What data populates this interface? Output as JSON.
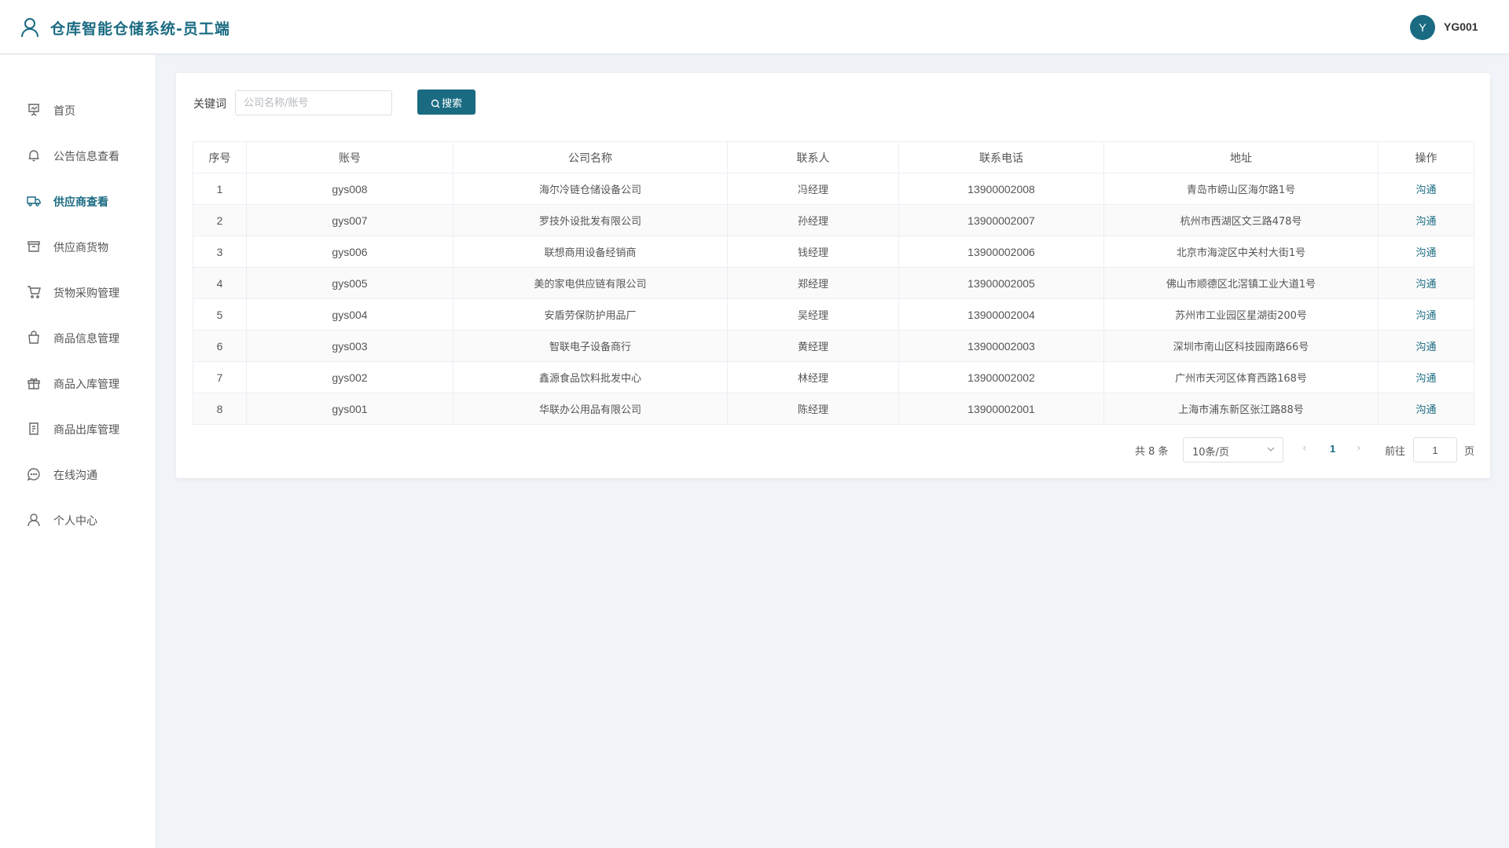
{
  "header": {
    "title": "仓库智能仓储系统-员工端",
    "avatar_letter": "Y",
    "username": "YG001"
  },
  "sidebar": {
    "items": [
      {
        "label": "首页",
        "icon": "presentation-icon"
      },
      {
        "label": "公告信息查看",
        "icon": "bell-icon"
      },
      {
        "label": "供应商查看",
        "icon": "truck-icon",
        "active": true
      },
      {
        "label": "供应商货物",
        "icon": "box-icon"
      },
      {
        "label": "货物采购管理",
        "icon": "cart-icon"
      },
      {
        "label": "商品信息管理",
        "icon": "bag-icon"
      },
      {
        "label": "商品入库管理",
        "icon": "present-icon"
      },
      {
        "label": "商品出库管理",
        "icon": "document-icon"
      },
      {
        "label": "在线沟通",
        "icon": "chat-icon"
      },
      {
        "label": "个人中心",
        "icon": "user-icon"
      }
    ]
  },
  "search": {
    "label": "关键词",
    "placeholder": "公司名称/账号",
    "value": "",
    "button_label": "搜索"
  },
  "table": {
    "columns": [
      "序号",
      "账号",
      "公司名称",
      "联系人",
      "联系电话",
      "地址",
      "操作"
    ],
    "rows": [
      [
        "1",
        "gys008",
        "海尔冷链仓储设备公司",
        "冯经理",
        "13900002008",
        "青岛市崂山区海尔路1号",
        "沟通"
      ],
      [
        "2",
        "gys007",
        "罗技外设批发有限公司",
        "孙经理",
        "13900002007",
        "杭州市西湖区文三路478号",
        "沟通"
      ],
      [
        "3",
        "gys006",
        "联想商用设备经销商",
        "钱经理",
        "13900002006",
        "北京市海淀区中关村大街1号",
        "沟通"
      ],
      [
        "4",
        "gys005",
        "美的家电供应链有限公司",
        "郑经理",
        "13900002005",
        "佛山市顺德区北滘镇工业大道1号",
        "沟通"
      ],
      [
        "5",
        "gys004",
        "安盾劳保防护用品厂",
        "吴经理",
        "13900002004",
        "苏州市工业园区星湖街200号",
        "沟通"
      ],
      [
        "6",
        "gys003",
        "智联电子设备商行",
        "黄经理",
        "13900002003",
        "深圳市南山区科技园南路66号",
        "沟通"
      ],
      [
        "7",
        "gys002",
        "鑫源食品饮料批发中心",
        "林经理",
        "13900002002",
        "广州市天河区体育西路168号",
        "沟通"
      ],
      [
        "8",
        "gys001",
        "华联办公用品有限公司",
        "陈经理",
        "13900002001",
        "上海市浦东新区张江路88号",
        "沟通"
      ]
    ]
  },
  "pagination": {
    "total_text": "共 8 条",
    "page_size": "10条/页",
    "current_page": "1",
    "goto_label": "前往",
    "goto_value": "1",
    "page_suffix": "页"
  },
  "colors": {
    "accent": "#1a6b82"
  }
}
